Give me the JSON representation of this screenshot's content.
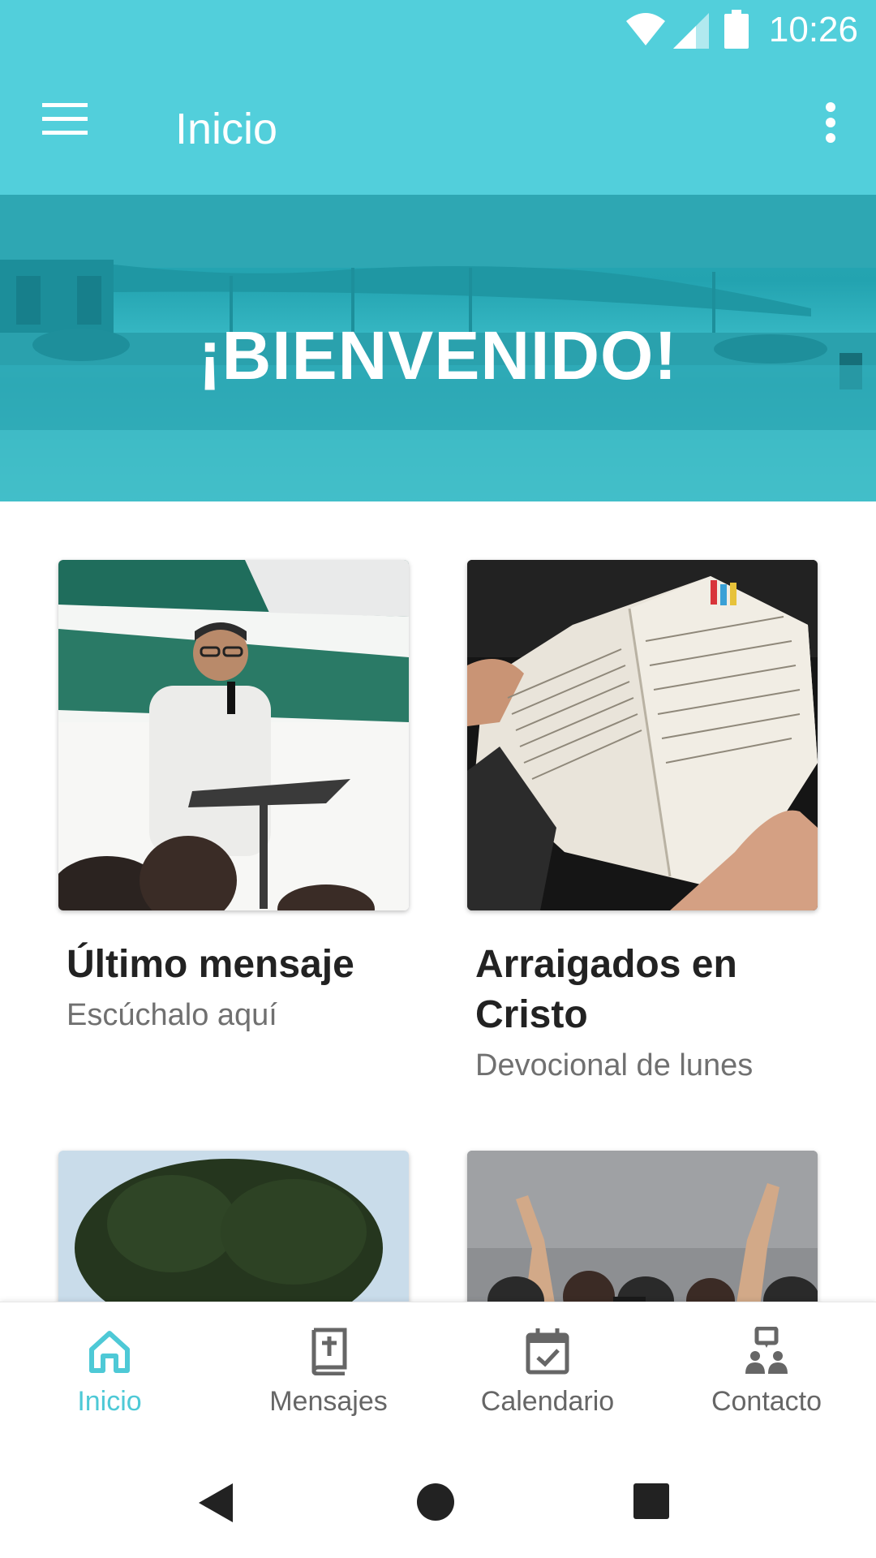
{
  "status": {
    "time": "10:26"
  },
  "appbar": {
    "title": "Inicio"
  },
  "banner": {
    "headline": "¡BIENVENIDO!"
  },
  "cards": [
    {
      "title": "Último mensaje",
      "subtitle": "Escúchalo aquí"
    },
    {
      "title": "Arraigados en Cristo",
      "subtitle": "Devocional de lunes"
    }
  ],
  "bottom_nav": {
    "items": [
      {
        "label": "Inicio",
        "icon": "home-icon",
        "active": true
      },
      {
        "label": "Mensajes",
        "icon": "bible-icon",
        "active": false
      },
      {
        "label": "Calendario",
        "icon": "calendar-check-icon",
        "active": false
      },
      {
        "label": "Contacto",
        "icon": "contact-icon",
        "active": false
      }
    ]
  },
  "colors": {
    "primary": "#52cfdb",
    "active": "#4ec9d6",
    "inactive": "#666666"
  }
}
